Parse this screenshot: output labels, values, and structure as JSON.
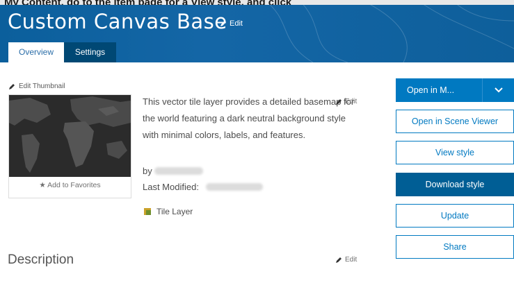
{
  "banner": {
    "top_cut_text": "My Content, go to the item page for a View style, and click"
  },
  "header": {
    "title": "Custom Canvas Base",
    "edit_label": "Edit",
    "tabs": [
      {
        "label": "Overview",
        "active": true
      },
      {
        "label": "Settings",
        "active": false
      }
    ]
  },
  "thumbnail": {
    "edit_label": "Edit Thumbnail",
    "favorites_label": "Add to Favorites"
  },
  "summary": {
    "text": "This vector tile layer provides a detailed basemap for the world featuring a dark neutral background style with minimal colors, labels, and features.",
    "edit_label": "Edit"
  },
  "meta": {
    "by_label": "by",
    "last_modified_label": "Last Modified:",
    "item_type": "Tile Layer"
  },
  "description": {
    "title": "Description",
    "edit_label": "Edit"
  },
  "actions": {
    "open_in_map": "Open in M...",
    "open_scene_viewer": "Open in Scene Viewer",
    "view_style": "View style",
    "download_style": "Download style",
    "update": "Update",
    "share": "Share"
  },
  "colors": {
    "banner": "#1466a6",
    "accent": "#0079c1",
    "active_button": "#005e95",
    "inactive_tab": "#004874"
  }
}
